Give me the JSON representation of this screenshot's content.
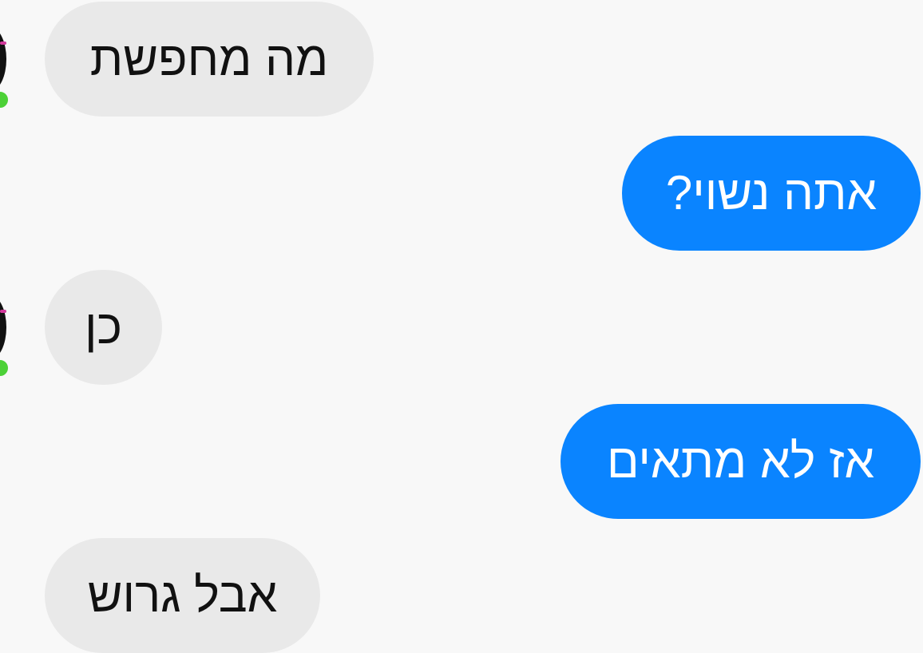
{
  "messages": [
    {
      "id": "m1",
      "direction": "incoming",
      "text": "מה מחפשת"
    },
    {
      "id": "m2",
      "direction": "outgoing",
      "text": "אתה נשוי?"
    },
    {
      "id": "m3",
      "direction": "incoming",
      "text": "כן"
    },
    {
      "id": "m4",
      "direction": "outgoing",
      "text": "אז לא מתאים"
    },
    {
      "id": "m5",
      "direction": "incoming",
      "text": "אבל גרוש"
    }
  ],
  "colors": {
    "background": "#f8f8f8",
    "incoming_bubble": "#e9e9e9",
    "outgoing_bubble": "#0a84ff",
    "online_indicator": "#4cd137"
  },
  "contact": {
    "online": true,
    "avatar_icon": "contact-avatar-icon",
    "status_icon": "online-status-icon"
  }
}
